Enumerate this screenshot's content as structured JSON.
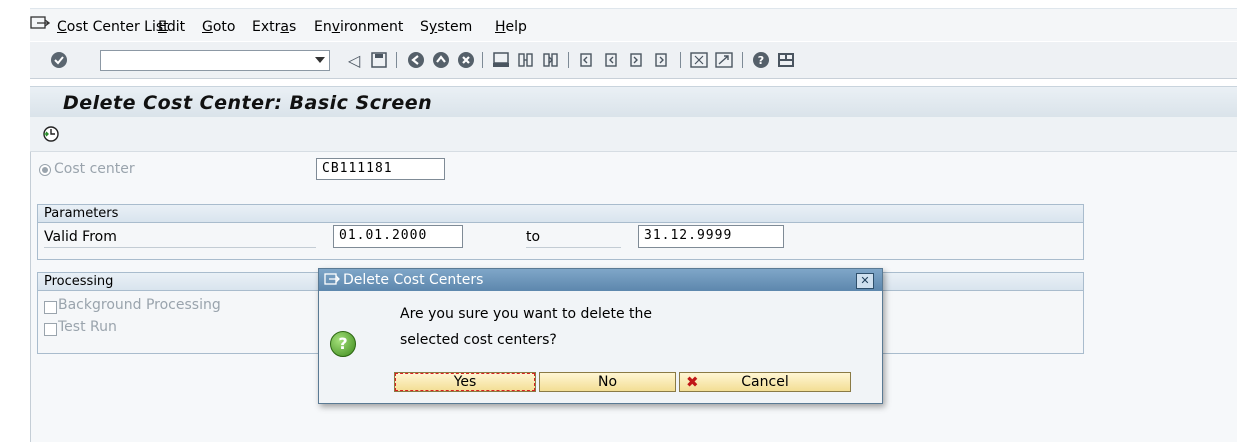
{
  "menubar": {
    "items": [
      "Cost Center List",
      "Edit",
      "Goto",
      "Extras",
      "Environment",
      "System",
      "Help"
    ],
    "mnemonics": [
      "C",
      "E",
      "G",
      "a",
      "v",
      "y",
      "H"
    ]
  },
  "toolbar": {
    "command_value": "",
    "icons": [
      "enter-icon",
      "back-icon",
      "save-icon",
      "back-green-icon",
      "exit-icon",
      "cancel-icon",
      "print-icon",
      "find-icon",
      "find-next-icon",
      "first-page-icon",
      "previous-page-icon",
      "next-page-icon",
      "last-page-icon",
      "create-session-icon",
      "shortcut-icon",
      "help-icon",
      "layout-icon"
    ]
  },
  "screen": {
    "title": "Delete Cost Center: Basic Screen"
  },
  "form": {
    "cost_center_label": "Cost center",
    "cost_center_value": "CB111181",
    "parameters": {
      "title": "Parameters",
      "valid_from_label": "Valid From",
      "valid_from_value": "01.01.2000",
      "to_label": "to",
      "valid_to_value": "31.12.9999"
    },
    "processing": {
      "title": "Processing",
      "background_label": "Background Processing",
      "test_run_label": "Test Run"
    }
  },
  "dialog": {
    "title": "Delete Cost Centers",
    "message_line1": "Are you sure you want to delete the",
    "message_line2": "selected cost centers?",
    "yes_label": "Yes",
    "no_label": "No",
    "cancel_label": "Cancel"
  }
}
